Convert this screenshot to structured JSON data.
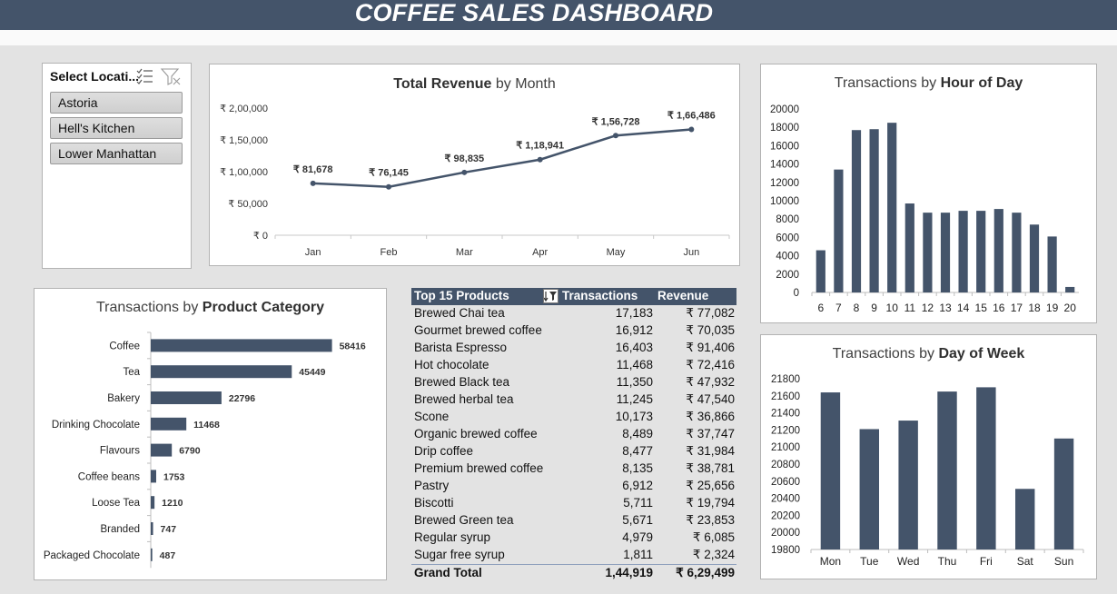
{
  "header": {
    "title": "COFFEE SALES DASHBOARD"
  },
  "slicer": {
    "title": "Select Locati...",
    "icons": [
      "multi-select-icon",
      "clear-filter-icon"
    ],
    "items": [
      "Astoria",
      "Hell's Kitchen",
      "Lower Manhattan"
    ]
  },
  "revenue_title": {
    "bold": "Total Revenue",
    "rest": " by Month"
  },
  "hour_title": {
    "rest": "Transactions by ",
    "bold": "Hour of Day"
  },
  "category_title": {
    "rest": "Transactions by ",
    "bold": "Product Category"
  },
  "dow_title": {
    "rest": "Transactions by ",
    "bold": "Day of Week"
  },
  "colors": {
    "accent": "#44546a",
    "line": "#44546a"
  },
  "chart_data": [
    {
      "id": "revenue",
      "type": "line",
      "categories": [
        "Jan",
        "Feb",
        "Mar",
        "Apr",
        "May",
        "Jun"
      ],
      "values": [
        81678,
        76145,
        98835,
        118941,
        156728,
        166486
      ],
      "labels": [
        "₹ 81,678",
        "₹ 76,145",
        "₹ 98,835",
        "₹ 1,18,941",
        "₹ 1,56,728",
        "₹ 1,66,486"
      ],
      "yticks": [
        0,
        50000,
        100000,
        150000,
        200000
      ],
      "ytick_labels": [
        "₹ 0",
        "₹ 50,000",
        "₹ 1,00,000",
        "₹ 1,50,000",
        "₹ 2,00,000"
      ],
      "ylim": [
        0,
        200000
      ],
      "grid": false
    },
    {
      "id": "hour",
      "type": "bar",
      "categories": [
        "6",
        "7",
        "8",
        "9",
        "10",
        "11",
        "12",
        "13",
        "14",
        "15",
        "16",
        "17",
        "18",
        "19",
        "20"
      ],
      "values": [
        4600,
        13400,
        17700,
        17800,
        18500,
        9700,
        8700,
        8700,
        8900,
        8900,
        9100,
        8700,
        7400,
        6100,
        600
      ],
      "yticks": [
        0,
        2000,
        4000,
        6000,
        8000,
        10000,
        12000,
        14000,
        16000,
        18000,
        20000
      ],
      "ylim": [
        0,
        20000
      ],
      "grid": false
    },
    {
      "id": "category",
      "type": "bar",
      "orientation": "horizontal",
      "categories": [
        "Coffee",
        "Tea",
        "Bakery",
        "Drinking Chocolate",
        "Flavours",
        "Coffee beans",
        "Loose Tea",
        "Branded",
        "Packaged Chocolate"
      ],
      "values": [
        58416,
        45449,
        22796,
        11468,
        6790,
        1753,
        1210,
        747,
        487
      ],
      "labels": [
        "58416",
        "45449",
        "22796",
        "11468",
        "6790",
        "1753",
        "1210",
        "747",
        "487"
      ],
      "xlim": [
        0,
        60000
      ],
      "grid": false
    },
    {
      "id": "dow",
      "type": "bar",
      "categories": [
        "Mon",
        "Tue",
        "Wed",
        "Thu",
        "Fri",
        "Sat",
        "Sun"
      ],
      "values": [
        21640,
        21210,
        21310,
        21650,
        21700,
        20510,
        21100
      ],
      "yticks": [
        19800,
        20000,
        20200,
        20400,
        20600,
        20800,
        21000,
        21200,
        21400,
        21600,
        21800
      ],
      "ylim": [
        19800,
        21800
      ],
      "grid": false
    },
    {
      "id": "top_products",
      "type": "table",
      "columns": [
        "Top 15 Products",
        "Transactions",
        "Revenue"
      ],
      "rows": [
        [
          "Brewed Chai tea",
          "17,183",
          "₹ 77,082"
        ],
        [
          "Gourmet brewed coffee",
          "16,912",
          "₹ 70,035"
        ],
        [
          "Barista Espresso",
          "16,403",
          "₹ 91,406"
        ],
        [
          "Hot chocolate",
          "11,468",
          "₹ 72,416"
        ],
        [
          "Brewed Black tea",
          "11,350",
          "₹ 47,932"
        ],
        [
          "Brewed herbal tea",
          "11,245",
          "₹ 47,540"
        ],
        [
          "Scone",
          "10,173",
          "₹ 36,866"
        ],
        [
          "Organic brewed coffee",
          "8,489",
          "₹ 37,747"
        ],
        [
          "Drip coffee",
          "8,477",
          "₹ 31,984"
        ],
        [
          "Premium brewed coffee",
          "8,135",
          "₹ 38,781"
        ],
        [
          "Pastry",
          "6,912",
          "₹ 25,656"
        ],
        [
          "Biscotti",
          "5,711",
          "₹ 19,794"
        ],
        [
          "Brewed Green tea",
          "5,671",
          "₹ 23,853"
        ],
        [
          "Regular syrup",
          "4,979",
          "₹ 6,085"
        ],
        [
          "Sugar free syrup",
          "1,811",
          "₹ 2,324"
        ]
      ],
      "total": [
        "Grand Total",
        "1,44,919",
        "₹ 6,29,499"
      ]
    }
  ]
}
